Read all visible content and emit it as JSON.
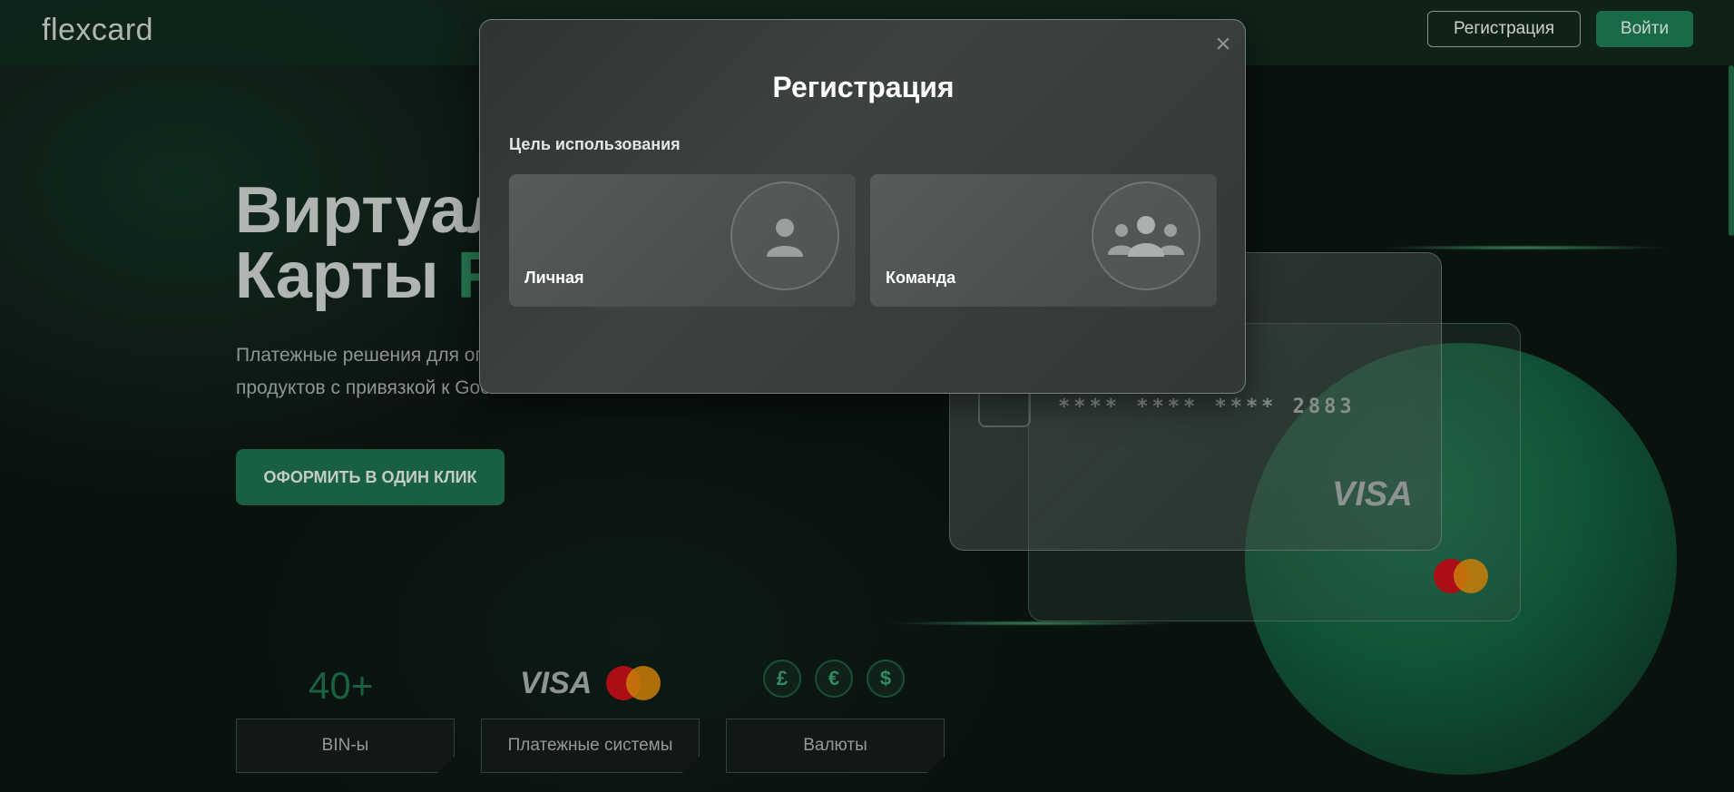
{
  "header": {
    "logo": "flexcard",
    "register_label": "Регистрация",
    "login_label": "Войти"
  },
  "hero": {
    "title_line1": "Виртуал",
    "title_line2_a": "Карты ",
    "title_line2_b": "F",
    "subtitle_line1": "Платежные решения для оп",
    "subtitle_line2": "продуктов с привязкой к Goo",
    "cta_label": "ОФОРМИТЬ В ОДИН КЛИК"
  },
  "card": {
    "number": "**** **** **** 2883",
    "brand": "VISA"
  },
  "stats": {
    "bins_value": "40+",
    "bins_label": "BIN-ы",
    "payment_brand": "VISA",
    "payment_label": "Платежные системы",
    "currencies": [
      "£",
      "€",
      "$"
    ],
    "currencies_label": "Валюты"
  },
  "modal": {
    "title": "Регистрация",
    "close_icon": "×",
    "purpose_label": "Цель использования",
    "options": [
      {
        "label": "Личная",
        "icon": "user-icon"
      },
      {
        "label": "Команда",
        "icon": "team-icon"
      }
    ]
  },
  "colors": {
    "accent": "#1c7a51",
    "background": "#0c1511",
    "mastercard_red": "#c4101a",
    "mastercard_orange": "#e8900c"
  }
}
